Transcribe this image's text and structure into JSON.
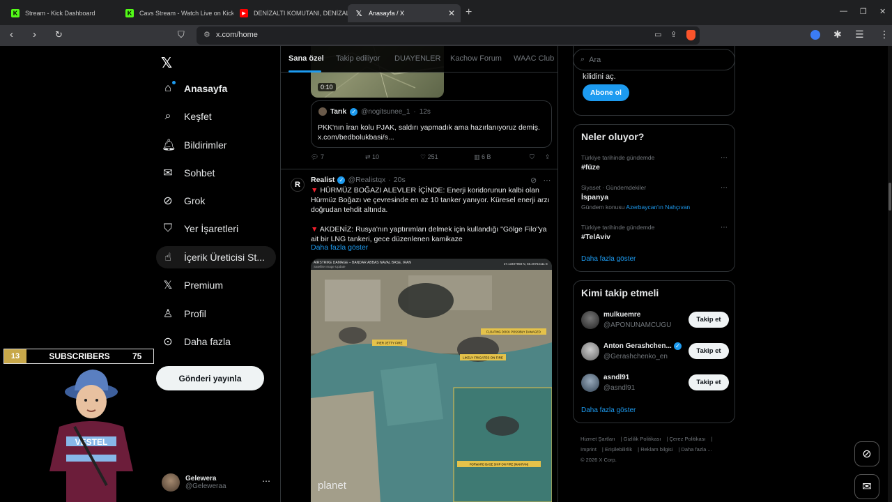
{
  "browser": {
    "tabs": [
      {
        "title": "Stream - Kick Dashboard",
        "favicon": "kick-icon"
      },
      {
        "title": "Cavs Stream - Watch Live on Kick",
        "favicon": "kick-icon"
      },
      {
        "title": "DENİZALTI KOMUTANI, DENİZALTI SA",
        "favicon": "youtube-icon"
      },
      {
        "title": "Anasayfa / X",
        "favicon": "x-icon"
      }
    ],
    "url": "x.com/home"
  },
  "sidebar": {
    "items": [
      {
        "label": "Anasayfa",
        "icon": "home-icon"
      },
      {
        "label": "Keşfet",
        "icon": "search-icon"
      },
      {
        "label": "Bildirimler",
        "icon": "bell-icon"
      },
      {
        "label": "Sohbet",
        "icon": "mail-icon"
      },
      {
        "label": "Grok",
        "icon": "grok-icon"
      },
      {
        "label": "Yer İşaretleri",
        "icon": "bookmark-icon"
      },
      {
        "label": "İçerik Üreticisi St...",
        "icon": "lightning-icon"
      },
      {
        "label": "Premium",
        "icon": "x-icon"
      },
      {
        "label": "Profil",
        "icon": "person-icon"
      },
      {
        "label": "Daha fazla",
        "icon": "more-circle-icon"
      }
    ],
    "post_button": "Gönderi yayınla",
    "account": {
      "name": "Gelewera",
      "handle": "@Geleweraa"
    }
  },
  "overlay": {
    "count": "13",
    "label": "SUBSCRIBERS",
    "goal": "75"
  },
  "timeline": {
    "tabs": [
      "Sana özel",
      "Takip ediliyor",
      "DUAYENLER",
      "Kachow Forum",
      "WAAC Club"
    ],
    "post1": {
      "video_time": "0:10",
      "quote": {
        "name": "Tarık",
        "handle": "@nogitsunee_1",
        "time": "12s",
        "text": "PKK'nın İran kolu PJAK, saldırı yapmadık ama hazırlanıyoruz demiş. x.com/bedbolukbasi/s..."
      },
      "replies": "7",
      "reposts": "10",
      "likes": "251",
      "views": "6 B"
    },
    "post2": {
      "name": "Realist",
      "handle": "@Realistqx",
      "time": "20s",
      "para1": "HÜRMÜZ BOĞAZI ALEVLER İÇİNDE: Enerji koridorunun kalbi olan Hürmüz Boğazı ve çevresinde en az 10 tanker yanıyor. Küresel enerji arzı doğrudan tehdit altında.",
      "para2": "AKDENİZ: Rusya'nın yaptırımları delmek için kullandığı \"Gölge Filo\"ya ait bir LNG tankeri, gece düzenlenen kamikaze",
      "show_more": "Daha fazla göster",
      "image": {
        "header": "AIRSTRIKE DAMAGE – BANDAR ABBAS NAVAL BASE, IRAN",
        "subheader": "Satellite Image Update",
        "coords": "27.13407958 N, 56.20754111 E",
        "labels": [
          "PIER JETTY FIRE",
          "FLOATING DOCK POSSIBLY DAMAGED",
          "LIKELY FRIGATES ON FIRE",
          "FORWARD BASE SHIP ON FIRE (MAKRAN)"
        ],
        "watermark": "planet"
      }
    }
  },
  "right": {
    "search_placeholder": "Ara",
    "premium": {
      "text": "kilidini aç.",
      "button": "Abone ol"
    },
    "trends": {
      "title": "Neler oluyor?",
      "items": [
        {
          "meta": "Türkiye tarihinde gündemde",
          "topic": "#füze"
        },
        {
          "meta": "Siyaset · Gündemdekiler",
          "topic": "İspanya",
          "sub_prefix": "Gündem konusu",
          "sub_link": "Azerbaycan'ın Nahçıvan"
        },
        {
          "meta": "Türkiye tarihinde gündemde",
          "topic": "#TelAviv"
        }
      ],
      "show_more": "Daha fazla göster"
    },
    "who_to_follow": {
      "title": "Kimi takip etmeli",
      "items": [
        {
          "name": "mulkuemre",
          "handle": "@APONUNAMCUGU",
          "button": "Takip et"
        },
        {
          "name": "Anton Gerashchen...",
          "handle": "@Gerashchenko_en",
          "button": "Takip et"
        },
        {
          "name": "asndl91",
          "handle": "@asndl91",
          "button": "Takip et"
        }
      ],
      "show_more": "Daha fazla göster"
    },
    "footer": [
      "Hizmet Şartları",
      "Gizlilik Politikası",
      "Çerez Politikası",
      "Imprint",
      "Erişilebilirlik",
      "Reklam bilgisi",
      "Daha fazla ...",
      "© 2026 X Corp."
    ]
  },
  "colors": {
    "accent": "#1d9bf0",
    "background": "#000000",
    "border": "#2f3336",
    "muted": "#71767b"
  }
}
